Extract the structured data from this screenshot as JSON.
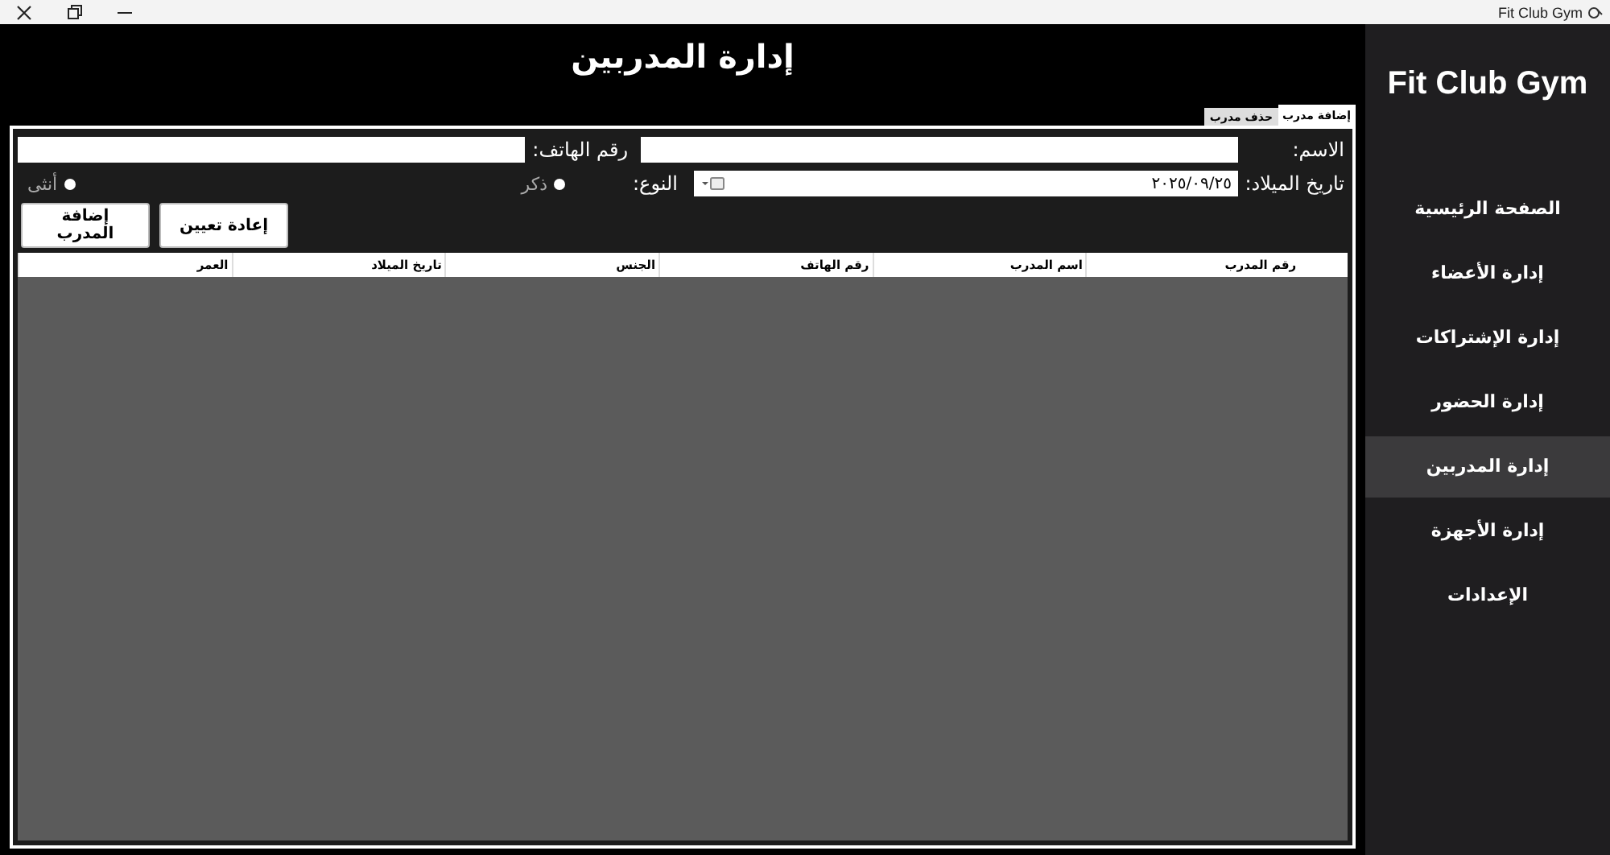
{
  "window": {
    "title": "Fit Club Gym"
  },
  "page_title": "إدارة المدربين",
  "tabs": [
    {
      "label": "إضافة مدرب",
      "selected": true
    },
    {
      "label": "حذف مدرب",
      "selected": false
    }
  ],
  "form": {
    "name_label": "الاسم:",
    "phone_label": "رقم الهاتف:",
    "birth_label": "تاريخ الميلاد:",
    "birth_value": "٢٠٢٥/٠٩/٢٥",
    "gender_label": "النوع:",
    "genders": [
      {
        "label": "ذكر",
        "selected": false
      },
      {
        "label": "أنثى",
        "selected": false
      }
    ]
  },
  "buttons": [
    {
      "label": "إعادة تعيين"
    },
    {
      "label": "إضافة المدرب"
    }
  ],
  "table": {
    "columns": [
      "رقم المدرب",
      "اسم المدرب",
      "رقم الهاتف",
      "الجنس",
      "تاريخ الميلاد",
      "العمر"
    ]
  },
  "sidebar": {
    "brand": "Fit Club Gym",
    "items": [
      {
        "label": "الصفحة الرئيسية",
        "selected": false
      },
      {
        "label": "إدارة الأعضاء",
        "selected": false
      },
      {
        "label": "إدارة الإشتراكات",
        "selected": false
      },
      {
        "label": "إدارة الحضور",
        "selected": false
      },
      {
        "label": "إدارة المدربين",
        "selected": true
      },
      {
        "label": "إدارة الأجهزة",
        "selected": false
      },
      {
        "label": "الإعدادات",
        "selected": false
      }
    ]
  }
}
